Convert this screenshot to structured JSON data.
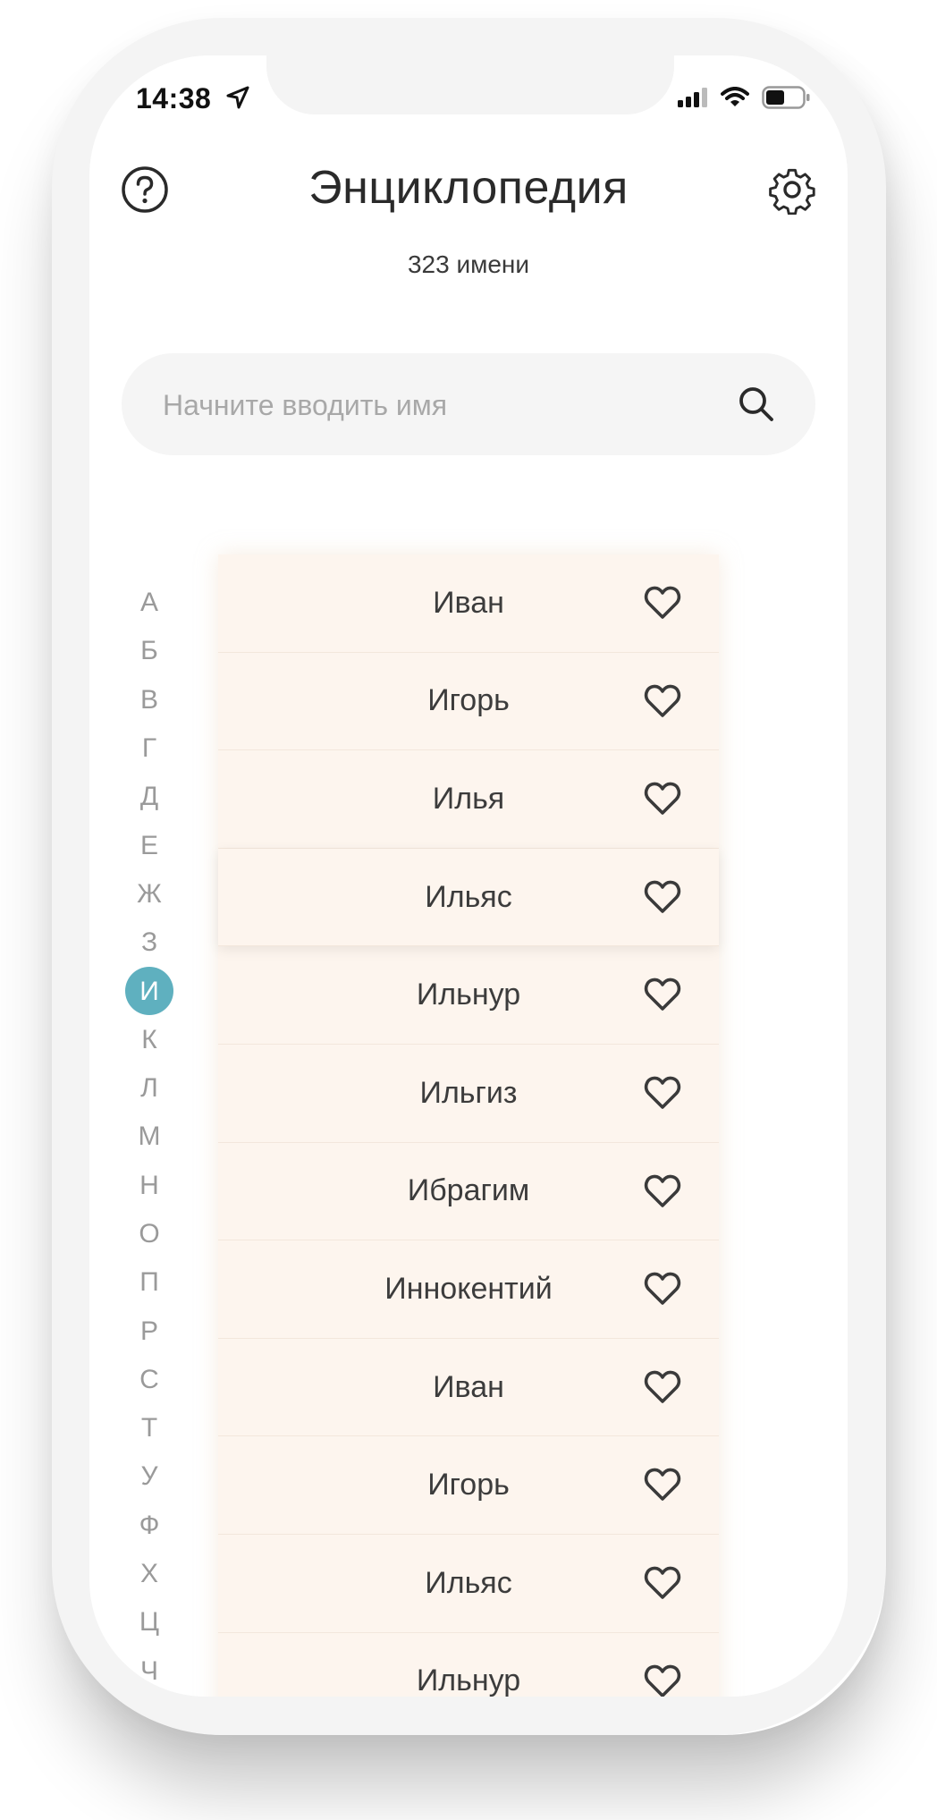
{
  "status_bar": {
    "time": "14:38"
  },
  "header": {
    "title": "Энциклопедия",
    "subtitle": "323 имени",
    "help_icon": "help-icon",
    "settings_icon": "gear-icon"
  },
  "search": {
    "placeholder": "Начните вводить имя",
    "value": ""
  },
  "alphabet": {
    "letters": [
      "А",
      "Б",
      "В",
      "Г",
      "Д",
      "Е",
      "Ж",
      "З",
      "И",
      "К",
      "Л",
      "М",
      "Н",
      "О",
      "П",
      "Р",
      "С",
      "Т",
      "У",
      "Ф",
      "Х",
      "Ц",
      "Ч"
    ],
    "active": "И",
    "accent_color": "#5fb0bf"
  },
  "names": {
    "items": [
      "Иван",
      "Игорь",
      "Илья",
      "Ильяс",
      "Ильнур",
      "Ильгиз",
      "Ибрагим",
      "Иннокентий",
      "Иван",
      "Игорь",
      "Ильяс",
      "Ильнур"
    ],
    "selected_index": 3,
    "background_color": "#fdf5ee"
  }
}
